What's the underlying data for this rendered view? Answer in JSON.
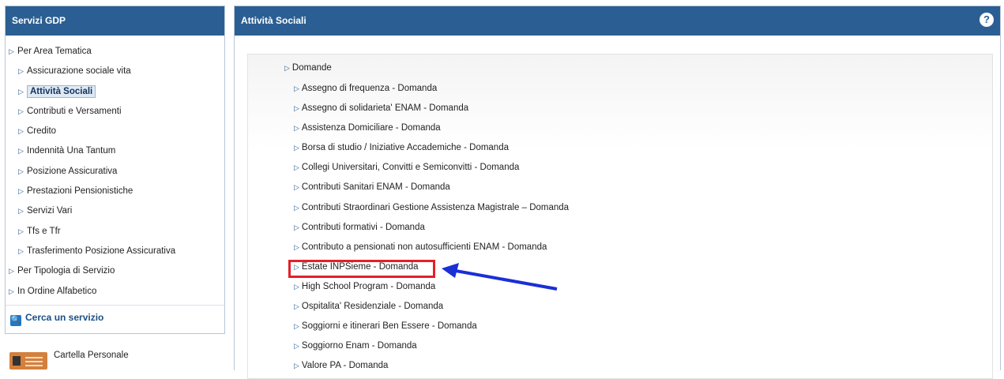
{
  "left_panel": {
    "title": "Servizi GDP",
    "nav": [
      {
        "label": "Per Area Tematica",
        "level": 1
      },
      {
        "label": "Assicurazione sociale vita",
        "level": 2
      },
      {
        "label": "Attività Sociali",
        "level": 2,
        "active": true
      },
      {
        "label": "Contributi e Versamenti",
        "level": 2
      },
      {
        "label": "Credito",
        "level": 2
      },
      {
        "label": "Indennità Una Tantum",
        "level": 2
      },
      {
        "label": "Posizione Assicurativa",
        "level": 2
      },
      {
        "label": "Prestazioni Pensionistiche",
        "level": 2
      },
      {
        "label": "Servizi Vari",
        "level": 2
      },
      {
        "label": "Tfs e Tfr",
        "level": 2
      },
      {
        "label": "Trasferimento Posizione Assicurativa",
        "level": 2
      },
      {
        "label": "Per Tipologia di Servizio",
        "level": 1
      },
      {
        "label": "In Ordine Alfabetico",
        "level": 1
      }
    ],
    "search_label": "Cerca un servizio",
    "cartella_label": "Cartella Personale"
  },
  "main_panel": {
    "title": "Attività Sociali",
    "help_icon": "?",
    "section_title": "Domande",
    "links": [
      "Assegno di frequenza - Domanda",
      "Assegno di solidarieta' ENAM - Domanda",
      "Assistenza Domiciliare - Domanda",
      "Borsa di studio / Iniziative Accademiche - Domanda",
      "Collegi Universitari, Convitti e Semiconvitti - Domanda",
      "Contributi Sanitari ENAM - Domanda",
      "Contributi Straordinari Gestione Assistenza Magistrale – Domanda",
      "Contributi formativi - Domanda",
      "Contributo a pensionati non autosufficienti ENAM - Domanda",
      "Estate INPSieme - Domanda",
      "High School Program - Domanda",
      "Ospitalita' Residenziale - Domanda",
      "Soggiorni e itinerari Ben Essere - Domanda",
      "Soggiorno Enam - Domanda",
      "Valore PA - Domanda"
    ],
    "highlighted_link_index": 9
  },
  "colors": {
    "header_blue": "#2b5f93",
    "highlight_red": "#e3202a",
    "arrow_blue": "#1a2fd6"
  }
}
